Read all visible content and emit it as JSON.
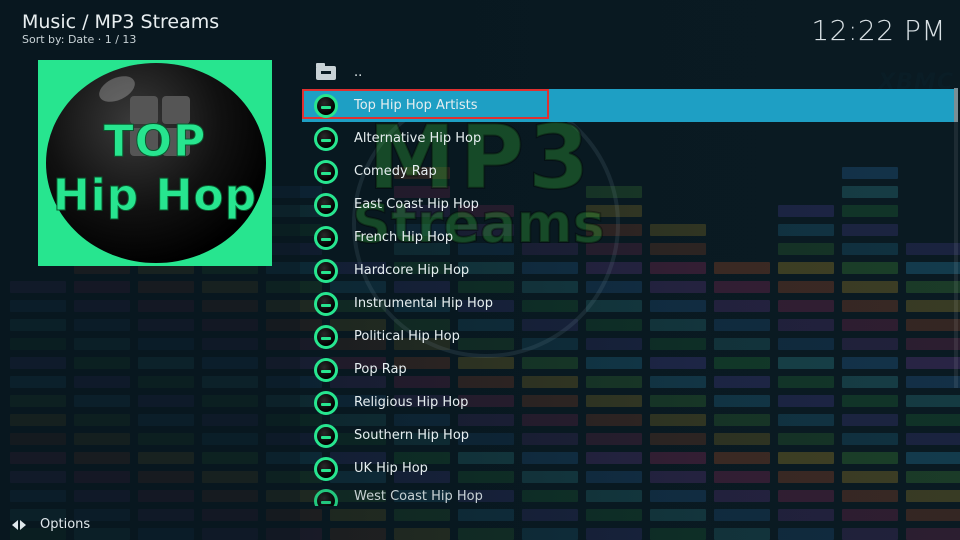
{
  "header": {
    "title": "Music / MP3 Streams",
    "subtitle": "Sort by: Date · 1 / 13"
  },
  "clock": "12:22 PM",
  "thumbnail": {
    "line1": "TOP",
    "line2": "Hip Hop"
  },
  "watermark": {
    "brand": "MP3",
    "sub": "Streams",
    "xbmc": "XBMC"
  },
  "list": {
    "parent_label": "..",
    "items": [
      {
        "label": "Top Hip Hop Artists",
        "selected": true
      },
      {
        "label": "Alternative Hip Hop"
      },
      {
        "label": "Comedy Rap"
      },
      {
        "label": "East Coast Hip Hop"
      },
      {
        "label": "French Hip Hop"
      },
      {
        "label": "Hardcore Hip Hop"
      },
      {
        "label": "Instrumental Hip Hop"
      },
      {
        "label": "Political Hip Hop"
      },
      {
        "label": "Pop Rap"
      },
      {
        "label": "Religious Hip Hop"
      },
      {
        "label": "Southern Hip Hop"
      },
      {
        "label": "UK Hip Hop"
      },
      {
        "label": "West Coast Hip Hop"
      }
    ]
  },
  "footer": {
    "options_label": "Options"
  },
  "colors": {
    "accent": "#1e9fc4",
    "thumb_green": "#27e58f",
    "focus_border": "#e03030"
  },
  "icons": {
    "parent": "folder-up-icon",
    "item": "hip-hop-thumb-icon",
    "options": "options-arrows-icon"
  }
}
